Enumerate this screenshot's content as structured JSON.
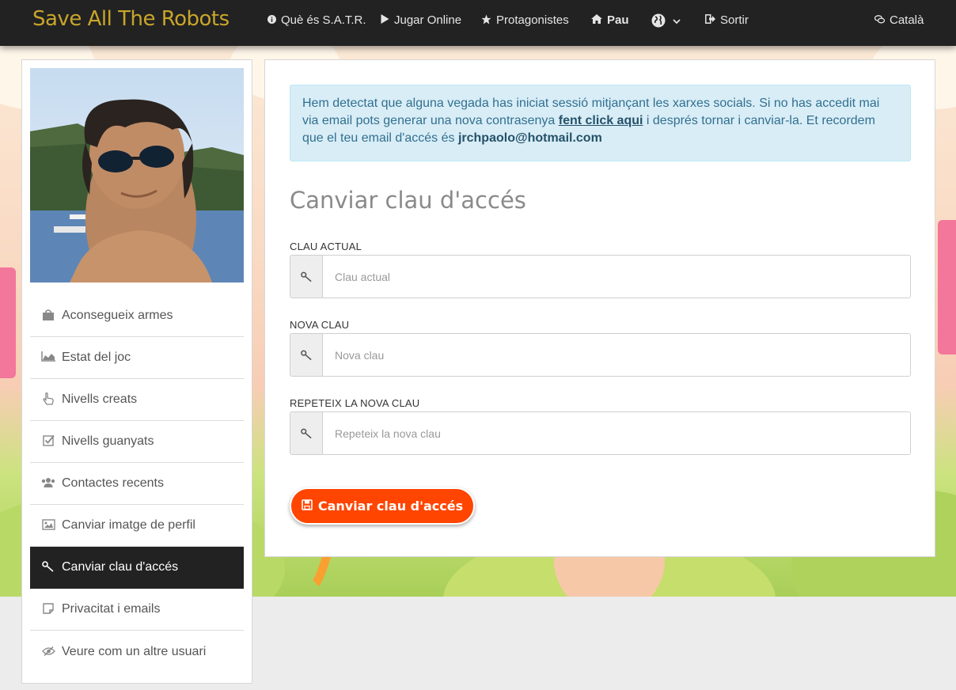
{
  "navbar": {
    "brand": "Save All The Robots",
    "items": [
      {
        "label": "Què és S.A.T.R.",
        "icon": "info-icon"
      },
      {
        "label": "Jugar Online",
        "icon": "play-icon"
      },
      {
        "label": "Protagonistes",
        "icon": "star-icon"
      },
      {
        "label": "Pau",
        "icon": "home-icon"
      },
      {
        "label": "",
        "icon": "globe-icon"
      },
      {
        "label": "Sortir",
        "icon": "sign-out-icon"
      }
    ],
    "language": {
      "label": "Català",
      "icon": "chat-icon"
    }
  },
  "sidebar": {
    "items": [
      {
        "label": "Aconsegueix armes",
        "icon": "shopping-bag-icon"
      },
      {
        "label": "Estat del joc",
        "icon": "area-chart-icon"
      },
      {
        "label": "Nivells creats",
        "icon": "hand-pointer-icon"
      },
      {
        "label": "Nivells guanyats",
        "icon": "check-square-icon"
      },
      {
        "label": "Contactes recents",
        "icon": "users-icon"
      },
      {
        "label": "Canviar imatge de perfil",
        "icon": "image-icon"
      },
      {
        "label": "Canviar clau d'accés",
        "icon": "key-icon",
        "active": true
      },
      {
        "label": "Privacitat i emails",
        "icon": "sticky-note-icon"
      },
      {
        "label": "Veure com un altre usuari",
        "icon": "eye-slash-icon"
      }
    ]
  },
  "alert": {
    "text_before": "Hem detectat que alguna vegada has iniciat sessió mitjançant les xarxes socials. Si no has accedit mai via email pots generar una nova contrasenya ",
    "link": "fent click aqui",
    "text_middle": " i després tornar i canviar-la. Et recordem que el teu email d'accés és ",
    "email": "jrchpaolo@hotmail.com"
  },
  "form": {
    "title": "Canviar clau d'accés",
    "fields": [
      {
        "label": "Clau actual",
        "placeholder": "Clau actual",
        "value": ""
      },
      {
        "label": "Nova clau",
        "placeholder": "Nova clau",
        "value": ""
      },
      {
        "label": "Repeteix la nova clau",
        "placeholder": "Repeteix la nova clau",
        "value": ""
      }
    ],
    "submit_label": "Canviar clau d'accés",
    "submit_icon": "save-icon"
  },
  "colors": {
    "navbar_bg": "#222222",
    "brand": "#c9a52a",
    "submit": "#ff4500",
    "alert_bg": "#d9edf7",
    "alert_text": "#31708f"
  }
}
